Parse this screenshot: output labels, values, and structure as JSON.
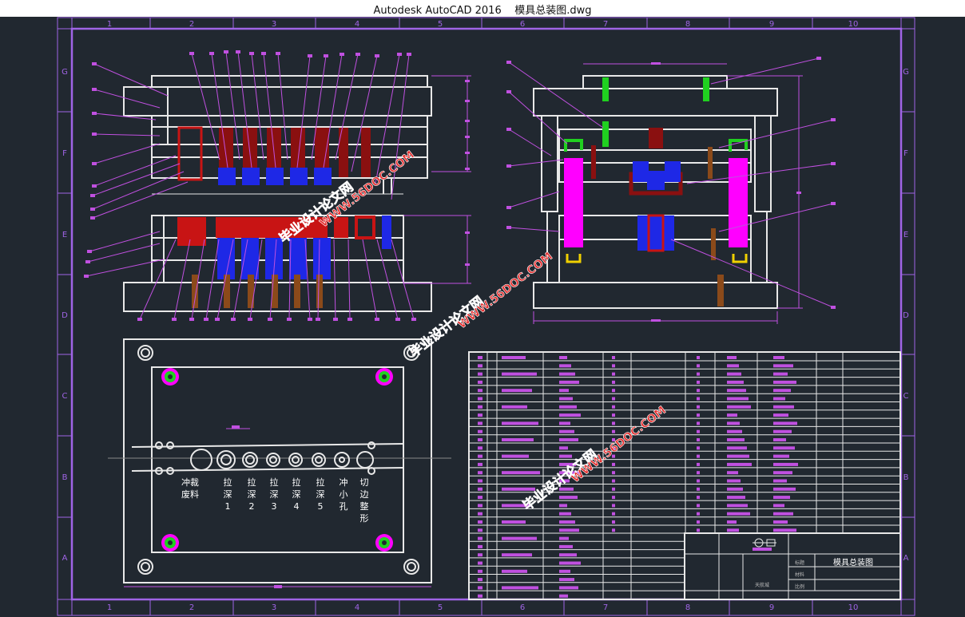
{
  "window": {
    "title": "Autodesk AutoCAD 2016",
    "file": "模具总装图.dwg"
  },
  "colors": {
    "bg": "#212830",
    "frame": "#a064e6",
    "line": "#e8e8e8",
    "leader": "#c050e0",
    "red": "#c81414",
    "blue": "#1e28e6",
    "magenta": "#ff00ff",
    "green": "#20d020",
    "brown": "#8b4a1a",
    "watermark": "#e63030"
  },
  "ruler": {
    "columns": [
      "1",
      "2",
      "3",
      "4",
      "5",
      "6",
      "7",
      "8",
      "9",
      "10"
    ],
    "rows": [
      "G",
      "F",
      "E",
      "D",
      "C",
      "B",
      "A"
    ]
  },
  "strip_labels": [
    {
      "id": "waste",
      "text": [
        "冲裁",
        "废料"
      ]
    },
    {
      "id": "draw1",
      "text": [
        "拉",
        "深",
        "1"
      ]
    },
    {
      "id": "draw2",
      "text": [
        "拉",
        "深",
        "2"
      ]
    },
    {
      "id": "draw3",
      "text": [
        "拉",
        "深",
        "3"
      ]
    },
    {
      "id": "draw4",
      "text": [
        "拉",
        "深",
        "4"
      ]
    },
    {
      "id": "draw5",
      "text": [
        "拉",
        "深",
        "5"
      ]
    },
    {
      "id": "pierce",
      "text": [
        "冲",
        "小",
        "孔"
      ]
    },
    {
      "id": "trim",
      "text": [
        "切",
        "边",
        "整",
        "形"
      ]
    }
  ],
  "title_block": {
    "drawing_name": "模具总装图",
    "label_name": "标题",
    "label_material": "材料",
    "label_scale": "比例",
    "label_company": "天航城"
  },
  "watermark": {
    "text1": "毕业设计论文网",
    "text2": "WWW.56DOC.COM"
  }
}
